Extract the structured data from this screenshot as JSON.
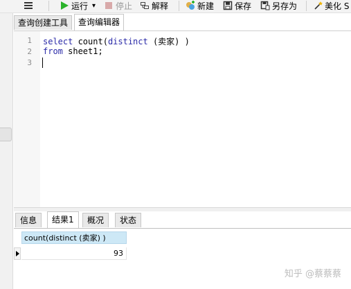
{
  "toolbar": {
    "run_label": "运行",
    "run_dropdown": "▾",
    "stop_label": "停止",
    "explain_label": "解释",
    "new_label": "新建",
    "save_label": "保存",
    "saveas_label": "另存为",
    "beautify_label": "美化 S"
  },
  "tabs": {
    "query_builder": "查询创建工具",
    "query_editor": "查询编辑器"
  },
  "editor": {
    "line_numbers": [
      "1",
      "2",
      "3"
    ],
    "line1_kw1": "select",
    "line1_mid": " count(",
    "line1_kw2": "distinct",
    "line1_end": " (卖家) )",
    "line2_kw": "from",
    "line2_end": " sheet1;"
  },
  "result_tabs": {
    "info": "信息",
    "result1": "结果1",
    "overview": "概况",
    "status": "状态"
  },
  "grid": {
    "column_header": "count(distinct (卖家) )",
    "value": "93"
  },
  "watermark": "知乎 @蔡蔡蔡",
  "colors": {
    "keyword": "#2a2aa8",
    "run_icon": "#2bb32b",
    "stop_icon": "#d8a9a9",
    "grid_header": "#cde8f6"
  }
}
